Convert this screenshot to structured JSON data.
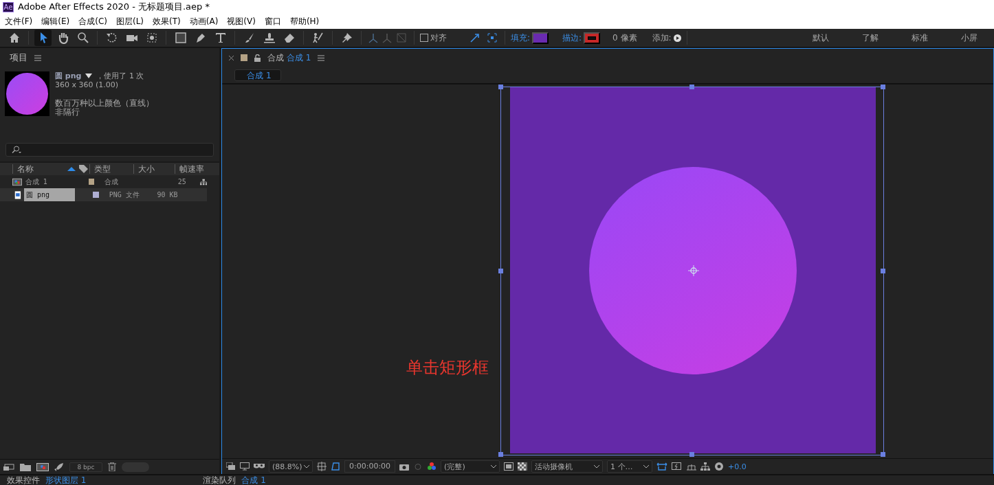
{
  "window": {
    "title": "Adobe After Effects 2020 - 无标题项目.aep *",
    "app_badge": "Ae"
  },
  "menu": [
    "文件(F)",
    "编辑(E)",
    "合成(C)",
    "图层(L)",
    "效果(T)",
    "动画(A)",
    "视图(V)",
    "窗口",
    "帮助(H)"
  ],
  "toolbar": {
    "tools": [
      {
        "selected": false
      },
      {
        "selected": true
      },
      {
        "selected": false
      },
      {
        "selected": false
      },
      {
        "selected": false
      },
      {
        "selected": false
      },
      {
        "selected": false
      },
      {
        "selected": false
      },
      {
        "selected": false
      },
      {
        "selected": false
      },
      {
        "selected": false
      },
      {
        "selected": false
      },
      {
        "selected": false
      },
      {
        "selected": false
      },
      {
        "selected": false
      }
    ],
    "snap": {
      "label": "对齐",
      "checked": false
    },
    "fill": {
      "label": "填充:",
      "color": "#6a2bb0"
    },
    "stroke": {
      "label": "描边:",
      "color": "#c62828"
    },
    "stroke_width": "0 像素",
    "add": {
      "label": "添加:"
    },
    "workspaces": [
      {
        "label": "默认",
        "selected": false
      },
      {
        "label": "了解",
        "selected": false
      },
      {
        "label": "标准",
        "selected": false
      },
      {
        "label": "小屏",
        "selected": false
      }
    ]
  },
  "project": {
    "title": "项目",
    "info": {
      "name": "圆 png",
      "usage": "，使用了 1 次",
      "dimensions": "360 x 360 (1.00)",
      "colors": "数百万种以上颜色（直线）",
      "field": "非隔行"
    },
    "columns": [
      "名称",
      "类型",
      "大小",
      "帧速率"
    ],
    "rows": [
      {
        "kind": "comp",
        "name": "合成 1",
        "color": "#b4a285",
        "type": "合成",
        "size": "",
        "fps": "25",
        "selected": false
      },
      {
        "kind": "image",
        "name": "圆 png",
        "color": "#aeaed2",
        "type": "PNG 文件",
        "size": "90 KB",
        "fps": "",
        "selected": true
      }
    ],
    "bit_depth": "8 bpc"
  },
  "composition": {
    "panel_label": "合成",
    "comp_name": "合成 1",
    "color": "#b4a285",
    "flow_tab": "合成 1",
    "annotation": "单击矩形框",
    "footer": {
      "zoom": "(88.8%)",
      "timecode": "0:00:00:00",
      "resolution": "(完整)",
      "camera": "活动摄像机",
      "views": "1 个…",
      "exposure": "+0.0"
    }
  },
  "bottom_panels": [
    {
      "label": "效果控件",
      "target": "形状图层 1"
    },
    {
      "label": "渲染队列",
      "target": "合成 1"
    }
  ]
}
